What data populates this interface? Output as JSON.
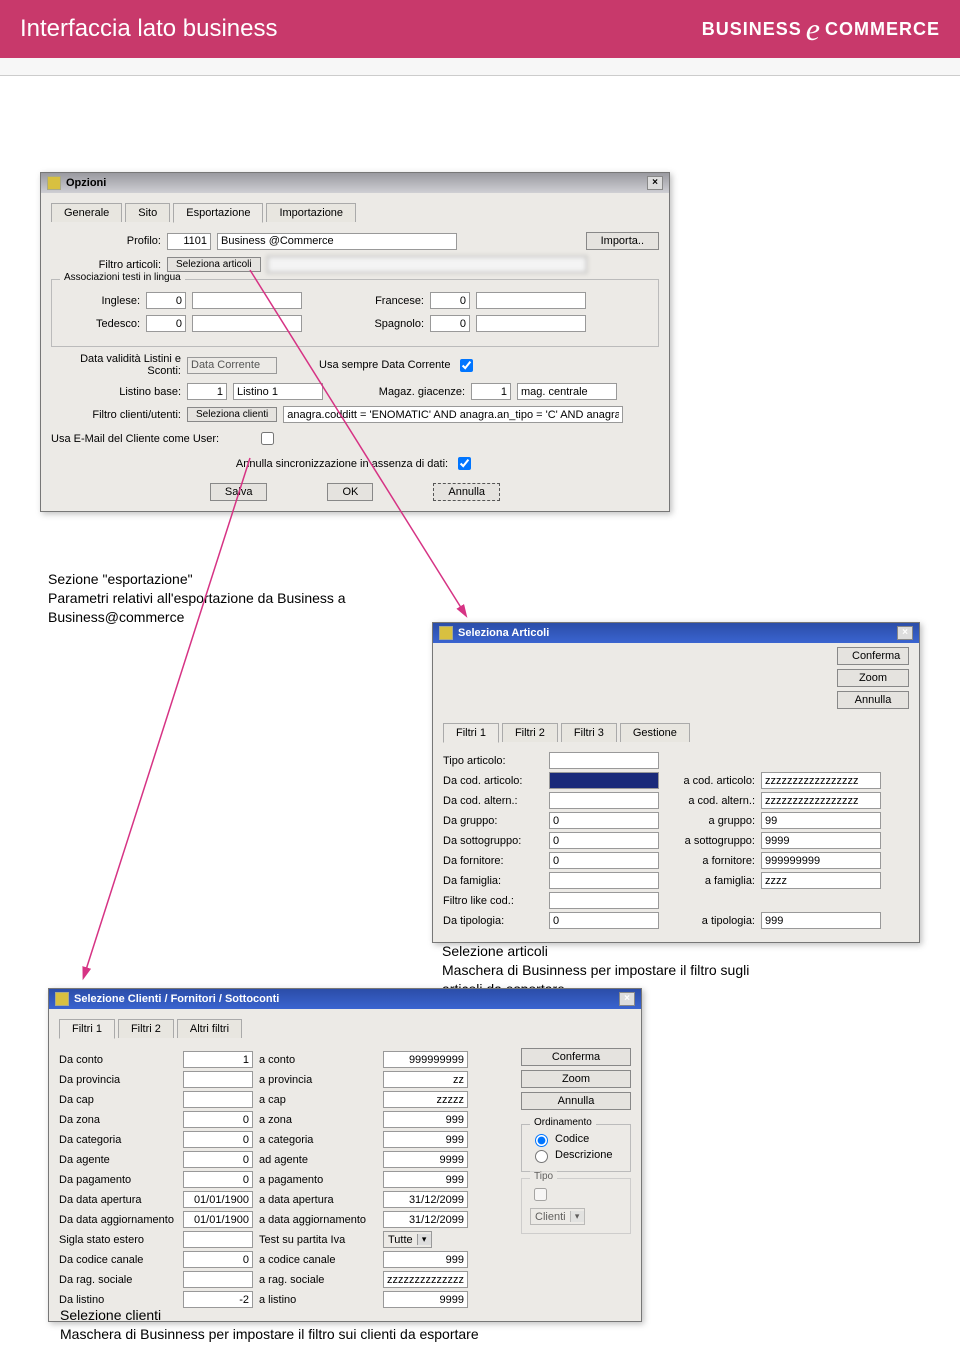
{
  "header": {
    "title": "Interfaccia lato business",
    "logo_left": "BUSINESS",
    "logo_right": "COMMERCE"
  },
  "captions": {
    "c1_line1": "Sezione \"esportazione\"",
    "c1_line2": "Parametri relativi all'esportazione da Business a Business@commerce",
    "c2_line1": "Selezione articoli",
    "c2_line2": "Maschera di Businness per impostare il filtro sugli articoli da esportare",
    "c3_line1": "Selezione clienti",
    "c3_line2": "Maschera di Businness per impostare il filtro sui clienti da esportare"
  },
  "options": {
    "title": "Opzioni",
    "tabs": [
      "Generale",
      "Sito",
      "Esportazione",
      "Importazione"
    ],
    "profilo_label": "Profilo:",
    "profilo_code": "1101",
    "profilo_name": "Business @Commerce",
    "importa_btn": "Importa..",
    "filtro_articoli_label": "Filtro articoli:",
    "seleziona_articoli_btn": "Seleziona articoli",
    "assoc_title": "Associazioni testi in lingua",
    "inglese_label": "Inglese:",
    "inglese_val": "0",
    "francese_label": "Francese:",
    "francese_val": "0",
    "tedesco_label": "Tedesco:",
    "tedesco_val": "0",
    "spagnolo_label": "Spagnolo:",
    "spagnolo_val": "0",
    "data_validita_label": "Data validità Listini e Sconti:",
    "data_validita_val": "Data Corrente",
    "usa_sempre_label": "Usa sempre Data Corrente",
    "listino_base_label": "Listino base:",
    "listino_base_code": "1",
    "listino_base_name": "Listino 1",
    "magaz_label": "Magaz. giacenze:",
    "magaz_code": "1",
    "magaz_name": "mag. centrale",
    "filtro_clienti_label": "Filtro clienti/utenti:",
    "seleziona_clienti_btn": "Seleziona clienti",
    "filtro_clienti_val": "anagra.codditt = 'ENOMATIC' AND anagra.an_tipo = 'C' AND anagra.an_co",
    "usa_email_label": "Usa E-Mail del Cliente come User:",
    "annulla_sync_label": "Annulla sincronizzazione in assenza di dati:",
    "btn_salva": "Salva",
    "btn_ok": "OK",
    "btn_annulla": "Annulla"
  },
  "articles": {
    "title": "Seleziona Articoli",
    "btn_conferma": "Conferma",
    "btn_zoom": "Zoom",
    "btn_annulla": "Annulla",
    "tabs": [
      "Filtri 1",
      "Filtri 2",
      "Filtri 3",
      "Gestione"
    ],
    "rows": [
      {
        "l1": "Tipo articolo:",
        "v1": "",
        "l2": "",
        "v2": ""
      },
      {
        "l1": "Da cod. articolo:",
        "v1": "",
        "l2": "a cod. articolo:",
        "v2": "zzzzzzzzzzzzzzzzz"
      },
      {
        "l1": "Da cod. altern.:",
        "v1": "",
        "l2": "a cod. altern.:",
        "v2": "zzzzzzzzzzzzzzzzz"
      },
      {
        "l1": "Da gruppo:",
        "v1": "0",
        "l2": "a gruppo:",
        "v2": "99"
      },
      {
        "l1": "Da sottogruppo:",
        "v1": "0",
        "l2": "a sottogruppo:",
        "v2": "9999"
      },
      {
        "l1": "Da fornitore:",
        "v1": "0",
        "l2": "a fornitore:",
        "v2": "999999999"
      },
      {
        "l1": "Da famiglia:",
        "v1": "",
        "l2": "a famiglia:",
        "v2": "zzzz"
      },
      {
        "l1": "Filtro like cod.:",
        "v1": "",
        "l2": "",
        "v2": ""
      },
      {
        "l1": "Da tipologia:",
        "v1": "0",
        "l2": "a tipologia:",
        "v2": "999"
      }
    ]
  },
  "clients": {
    "title": "Selezione Clienti / Fornitori / Sottoconti",
    "tabs": [
      "Filtri 1",
      "Filtri 2",
      "Altri filtri"
    ],
    "btns": {
      "conferma": "Conferma",
      "zoom": "Zoom",
      "annulla": "Annulla"
    },
    "ord_title": "Ordinamento",
    "ord_codice": "Codice",
    "ord_descr": "Descrizione",
    "tipo_title": "Tipo",
    "tipo_val": "Clienti",
    "rows": [
      {
        "l1": "Da conto",
        "v1": "1",
        "l2": "a conto",
        "v2": "999999999"
      },
      {
        "l1": "Da provincia",
        "v1": "",
        "l2": "a provincia",
        "v2": "zz"
      },
      {
        "l1": "Da cap",
        "v1": "",
        "l2": "a cap",
        "v2": "zzzzz"
      },
      {
        "l1": "Da zona",
        "v1": "0",
        "l2": "a zona",
        "v2": "999"
      },
      {
        "l1": "Da categoria",
        "v1": "0",
        "l2": "a categoria",
        "v2": "999"
      },
      {
        "l1": "Da agente",
        "v1": "0",
        "l2": "ad agente",
        "v2": "9999"
      },
      {
        "l1": "Da pagamento",
        "v1": "0",
        "l2": "a pagamento",
        "v2": "999"
      },
      {
        "l1": "Da data apertura",
        "v1": "01/01/1900",
        "l2": "a data apertura",
        "v2": "31/12/2099"
      },
      {
        "l1": "Da data aggiornamento",
        "v1": "01/01/1900",
        "l2": "a data aggiornamento",
        "v2": "31/12/2099"
      },
      {
        "l1": "Sigla stato estero",
        "v1": "",
        "l2": "Test su partita Iva",
        "v2": "Tutte"
      },
      {
        "l1": "Da codice canale",
        "v1": "0",
        "l2": "a codice canale",
        "v2": "999"
      },
      {
        "l1": "Da rag. sociale",
        "v1": "",
        "l2": "a rag. sociale",
        "v2": "zzzzzzzzzzzzzzz"
      },
      {
        "l1": "Da listino",
        "v1": "-2",
        "l2": "a listino",
        "v2": "9999"
      }
    ]
  }
}
